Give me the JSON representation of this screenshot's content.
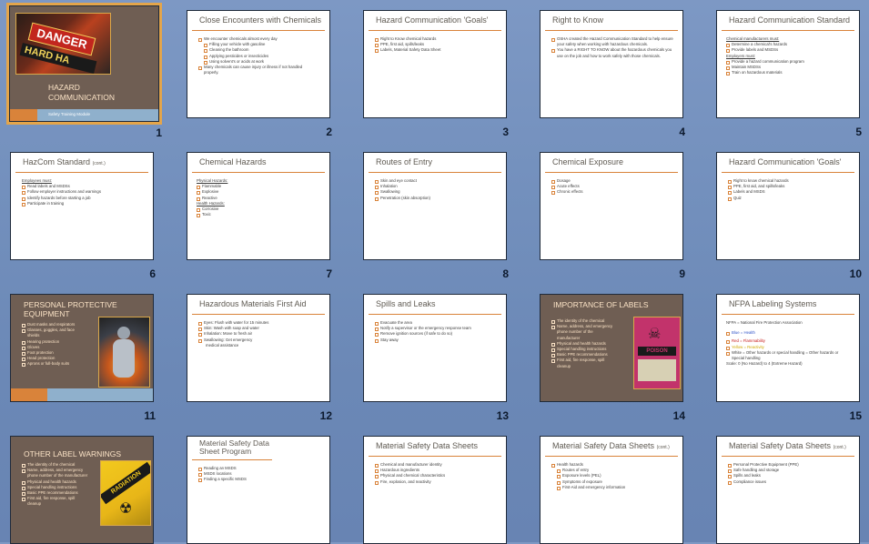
{
  "slides": [
    {
      "num": "1",
      "title": "HAZARD COMMUNICATION",
      "subtitle": "Safety Training Module",
      "sign_text": "DANGER",
      "sign_text2": "HARD HA"
    },
    {
      "num": "2",
      "title": "Close Encounters with Chemicals",
      "bullets": [
        "We encounter chemicals almost every day",
        "Filling your vehicle with gasoline",
        "Cleaning the bathroom",
        "Applying pesticides or insecticides",
        "Using solvent's or acids at work",
        "Many chemicals can cause injury or illness if not handled properly."
      ]
    },
    {
      "num": "3",
      "title": "Hazard Communication 'Goals'",
      "bullets": [
        "Right to Know chemical hazards",
        "PPE, first aid, spills/leaks",
        "Labels, Material Safety Data Sheet"
      ]
    },
    {
      "num": "4",
      "title": "Right to Know",
      "bullets": [
        "OSHA created the Hazard Communication Standard to help ensure your safety when working with hazardous chemicals.",
        "You have a RIGHT TO KNOW about the hazardous chemicals you use on the job and how to work safely with those chemicals."
      ]
    },
    {
      "num": "5",
      "title": "Hazard Communication Standard",
      "bullets": [
        "Chemical manufacturers must:",
        "Determine a chemical's hazards",
        "Provide labels and MSDSs",
        "Employers must:",
        "Provide a hazard communication program",
        "Maintain MSDSs",
        "Train on hazardous materials"
      ]
    },
    {
      "num": "6",
      "title": "HazCom Standard",
      "title_small": "(cont.)",
      "bullets": [
        "Employees must:",
        "Read labels and MSDSs",
        "Follow employer instructions and warnings",
        "Identify hazards before starting a job",
        "Participate in training"
      ]
    },
    {
      "num": "7",
      "title": "Chemical Hazards",
      "bullets": [
        "Physical Hazards:",
        "Flammable",
        "Explosive",
        "Reactive",
        "Health Hazards:",
        "Corrosive",
        "Toxic"
      ]
    },
    {
      "num": "8",
      "title": "Routes of Entry",
      "bullets": [
        "Skin and eye contact",
        "Inhalation",
        "Swallowing",
        "Penetration (skin absorption)"
      ]
    },
    {
      "num": "9",
      "title": "Chemical Exposure",
      "bullets": [
        "Dosage",
        "Acute effects",
        "Chronic effects"
      ]
    },
    {
      "num": "10",
      "title": "Hazard Communication 'Goals'",
      "bullets": [
        "Right to know chemical hazards",
        "PPE, first aid, and spills/leaks",
        "Labels and MSDS",
        "Quiz"
      ]
    },
    {
      "num": "11",
      "title": "PERSONAL PROTECTIVE EQUIPMENT",
      "bullets": [
        "Dust masks and respirators",
        "Glasses, goggles, and face shields",
        "Hearing protection",
        "Gloves",
        "Foot protection",
        "Head protection",
        "Aprons or full-body suits"
      ]
    },
    {
      "num": "12",
      "title": "Hazardous Materials First Aid",
      "bullets": [
        "Eyes: Flush with water for 15 minutes",
        "Skin: Wash with soap and water",
        "Inhalation: Move to fresh air",
        "Swallowing: Get emergency",
        "medical assistance"
      ]
    },
    {
      "num": "13",
      "title": "Spills and Leaks",
      "bullets": [
        "Evacuate the area",
        "Notify a supervisor or the emergency response team",
        "Remove ignition sources (if safe to do so)",
        "Stay away"
      ]
    },
    {
      "num": "14",
      "title": "IMPORTANCE OF LABELS",
      "bullets": [
        "The identity of the chemical",
        "Name, address, and emergency phone number of the manufacturer",
        "Physical and health hazards",
        "Special handling instructions",
        "Basic PPE recommendations",
        "First aid, fire response, spill cleanup"
      ],
      "label_text": "POISON"
    },
    {
      "num": "15",
      "title": "NFPA Labeling Systems",
      "lines": [
        "NFPA = National Fire Protection Association",
        "Blue = Health",
        "Red = Flammability",
        "Yellow = Reactivity",
        "White = Other hazards or special handling = Other hazards or Special handling",
        "Scale: 0 (No Hazard) to 4 (Extreme Hazard)"
      ]
    },
    {
      "num": "16",
      "title": "OTHER LABEL WARNINGS",
      "bullets": [
        "The identity of the chemical",
        "Name, address, and emergency phone number of the manufacturer",
        "Physical and health hazards",
        "Special handling instructions",
        "Basic PPE recommendations",
        "First aid, fire response, spill cleanup"
      ],
      "sign_text": "RADIATION"
    },
    {
      "num": "17",
      "title": "Material Safety Data Sheet Program",
      "bullets": [
        "Reading an MSDS",
        "MSDS locations",
        "Finding a specific MSDS"
      ]
    },
    {
      "num": "18",
      "title": "Material Safety Data Sheets",
      "bullets": [
        "Chemical and manufacturer identity",
        "Hazardous ingredients",
        "Physical and chemical characteristics",
        "Fire, explosion, and reactivity"
      ]
    },
    {
      "num": "19",
      "title": "Material Safety Data Sheets",
      "title_small": "(cont.)",
      "bullets": [
        "Health hazards",
        "Routes of entry",
        "Exposure levels (PEL)",
        "Symptoms of exposure",
        "First-Aid and emergency information"
      ]
    },
    {
      "num": "20",
      "title": "Material Safety Data Sheets",
      "title_small": "(cont.)",
      "bullets": [
        "Personal Protective Equipment (PPE)",
        "Safe handling and storage",
        "Spills and leaks",
        "Compliance issues"
      ]
    }
  ]
}
